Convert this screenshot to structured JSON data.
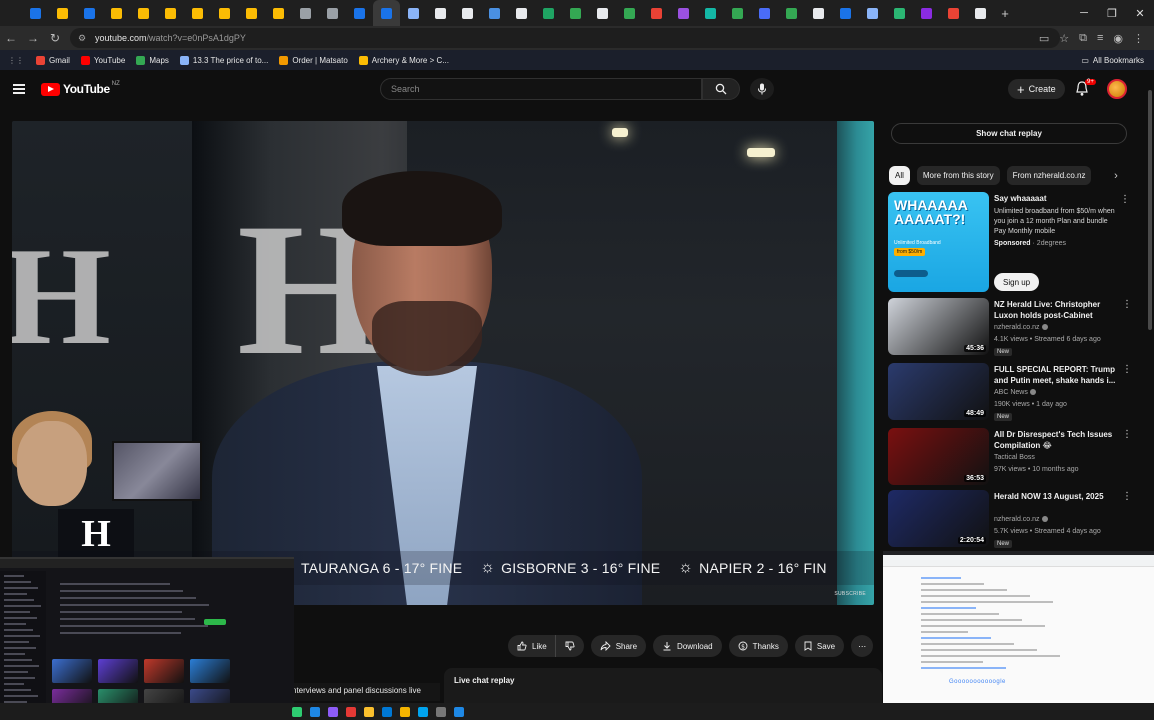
{
  "browser": {
    "url_host": "youtube.com",
    "url_path": "/watch?v=e0nPsA1dgPY",
    "bookmarks": [
      {
        "label": "Gmail",
        "color": "#ea4335"
      },
      {
        "label": "YouTube",
        "color": "#ff0000"
      },
      {
        "label": "Maps",
        "color": "#34a853"
      },
      {
        "label": "13.3 The price of to...",
        "color": "#8ab4f8"
      },
      {
        "label": "Order | Matsato",
        "color": "#f29900"
      },
      {
        "label": "Archery & More > C...",
        "color": "#fbbc04"
      }
    ],
    "all_bookmarks": "All Bookmarks",
    "tab_colors": [
      "#1a73e8",
      "#fbbc04",
      "#1a73e8",
      "#fbbc04",
      "#fbbc04",
      "#fbbc04",
      "#fbbc04",
      "#fbbc04",
      "#fbbc04",
      "#fbbc04",
      "#9aa0a6",
      "#9aa0a6",
      "#1a73e8",
      "#1a73e8",
      "#8ab4f8",
      "#e8eaed",
      "#e8eaed",
      "#4a90e2",
      "#e8eaed",
      "#1fa463",
      "#34a853",
      "#e8eaed",
      "#34a853",
      "#e94235",
      "#9b51e0",
      "#14b8a6",
      "#34a853",
      "#4a6cf7",
      "#34a853",
      "#e8eaed",
      "#1a73e8",
      "#8ab4f8",
      "#2bb673",
      "#8a2be2",
      "#ea4335",
      "#e8eaed"
    ]
  },
  "masthead": {
    "logo_text": "YouTube",
    "region": "NZ",
    "search_placeholder": "Search",
    "create_label": "Create",
    "notifications_badge": "9+"
  },
  "video": {
    "ticker": [
      "TAURANGA 6 - 17° FINE",
      "GISBORNE 3 - 16° FINE",
      "NAPIER 2 - 16° FIN"
    ],
    "watermark": "SUBSCRIBE"
  },
  "actions": {
    "like": "Like",
    "share": "Share",
    "download": "Download",
    "thanks": "Thanks",
    "save": "Save"
  },
  "below": {
    "live_chat_title": "Live chat replay",
    "description_snippet": "nterviews and panel discussions live"
  },
  "sidebar": {
    "show_chat_replay": "Show chat replay",
    "chips": [
      "All",
      "More from this story",
      "From nzherald.co.nz"
    ],
    "ad": {
      "thumb_text": "WHAAAAA AAAAAT?!",
      "thumb_sub": "Unlimited Broadband",
      "thumb_price": "from $50/m",
      "title": "Say whaaaaat",
      "description": "Unlimited broadband from $50/m when you join a 12 month Plan and bundle Pay Monthly mobile",
      "sponsored": "Sponsored",
      "advertiser": "2degrees",
      "cta": "Sign up"
    },
    "recommendations": [
      {
        "title": "NZ Herald Live: Christopher Luxon holds post-Cabinet pres...",
        "channel": "nzherald.co.nz",
        "meta": "4.1K views • Streamed 6 days ago",
        "badge": "New",
        "duration": "45:36",
        "thumb": "#cfd3da"
      },
      {
        "title": "FULL SPECIAL REPORT: Trump and Putin meet, shake hands i...",
        "channel": "ABC News",
        "meta": "190K views • 1 day ago",
        "badge": "New",
        "duration": "48:49",
        "thumb": "#2b3b6e"
      },
      {
        "title": "All Dr Disrespect's Tech Issues Compilation 😂",
        "channel": "Tactical Boss",
        "meta": "97K views • 10 months ago",
        "badge": "",
        "duration": "36:53",
        "thumb": "#7a1010"
      },
      {
        "title": "Herald NOW 13 August, 2025",
        "channel": "nzherald.co.nz",
        "meta": "5.7K views • Streamed 4 days ago",
        "badge": "New",
        "duration": "2:20:54",
        "thumb": "#1e2a66"
      }
    ]
  },
  "overlay_right": {
    "footer": "Gooooooooooogle"
  },
  "taskbar_colors": [
    "#2ecc71",
    "#1e88e5",
    "#8e5cf7",
    "#e53935",
    "#fbc02d",
    "#0078d4",
    "#f4b400",
    "#00a4ef",
    "#777",
    "#1e88e5"
  ]
}
